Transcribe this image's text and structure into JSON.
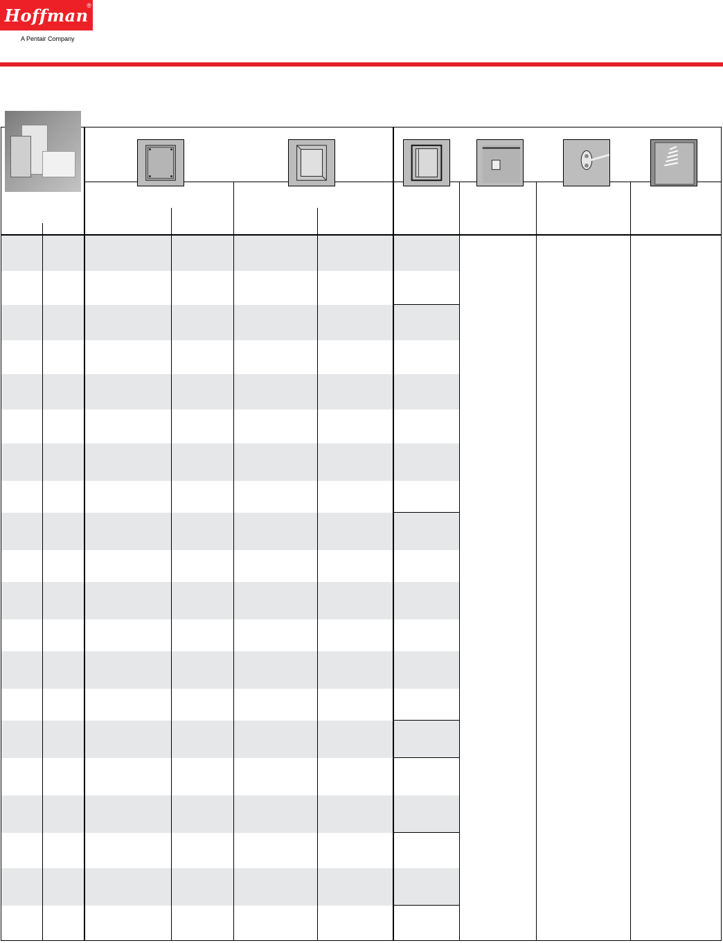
{
  "brand": {
    "name": "Hoffman",
    "registered": "®",
    "tagline": "A Pentair Company",
    "color": "#ed2027"
  },
  "accent_rule_color": "#e32026",
  "row_band_color": "#e6e7e9",
  "images": {
    "product_photo": "enclosure-product-photo",
    "icons": [
      "closed-enclosure-icon",
      "open-enclosure-icon",
      "frame-enclosure-icon",
      "wall-mount-bracket-icon",
      "cable-clamp-icon",
      "screw-set-icon"
    ]
  }
}
